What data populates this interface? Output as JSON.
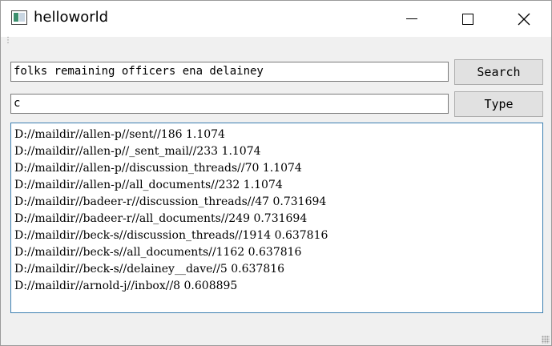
{
  "window": {
    "title": "helloworld"
  },
  "search": {
    "query": "folks remaining officers ena delainey",
    "button": "Search"
  },
  "type": {
    "value": "c",
    "button": "Type"
  },
  "results": [
    "D://maildir//allen-p//sent//186 1.1074",
    "D://maildir//allen-p//_sent_mail//233 1.1074",
    "D://maildir//allen-p//discussion_threads//70 1.1074",
    "D://maildir//allen-p//all_documents//232 1.1074",
    "D://maildir//badeer-r//discussion_threads//47 0.731694",
    "D://maildir//badeer-r//all_documents//249 0.731694",
    "D://maildir//beck-s//discussion_threads//1914 0.637816",
    "D://maildir//beck-s//all_documents//1162 0.637816",
    "D://maildir//beck-s//delainey__dave//5 0.637816",
    "D://maildir//arnold-j//inbox//8 0.608895"
  ]
}
